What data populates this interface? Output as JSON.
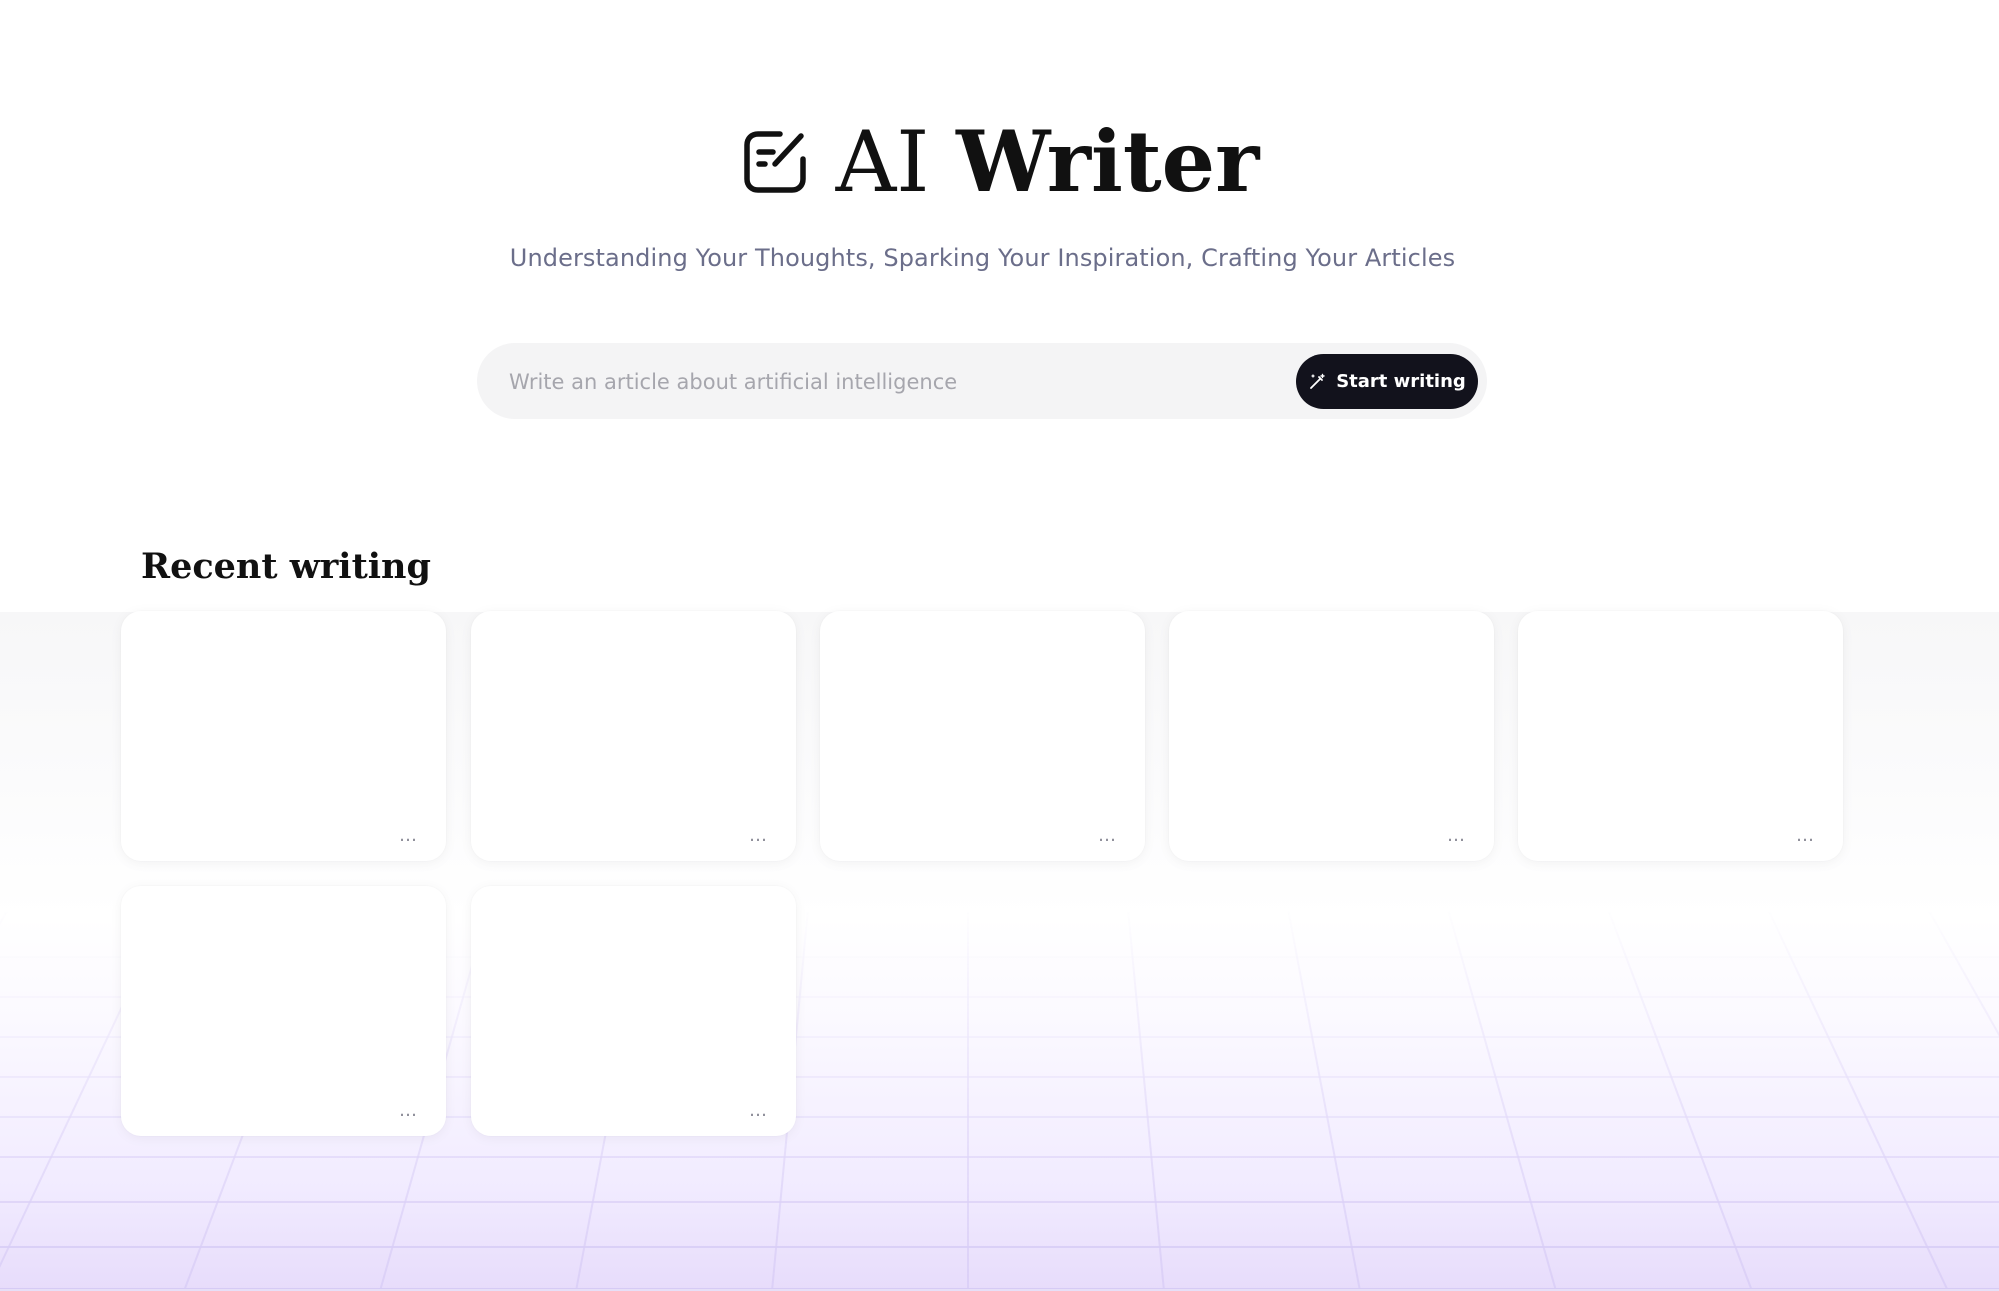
{
  "header": {
    "title_light": "AI",
    "title_bold": "Writer",
    "subtitle": "Understanding Your Thoughts, Sparking Your Inspiration, Crafting Your Articles",
    "logo_icon": "edit-note-icon"
  },
  "search": {
    "placeholder": "Write an article about artificial intelligence",
    "value": "",
    "button_label": "Start writing",
    "button_icon": "magic-wand-icon"
  },
  "recent": {
    "title": "Recent writing",
    "cards": [
      {
        "more_label": "…"
      },
      {
        "more_label": "…"
      },
      {
        "more_label": "…"
      },
      {
        "more_label": "…"
      },
      {
        "more_label": "…"
      },
      {
        "more_label": "…"
      },
      {
        "more_label": "…"
      }
    ]
  },
  "colors": {
    "accent_dark": "#12121c",
    "subtitle": "#6b6e8a",
    "grid_line": "#d8cdf6"
  }
}
